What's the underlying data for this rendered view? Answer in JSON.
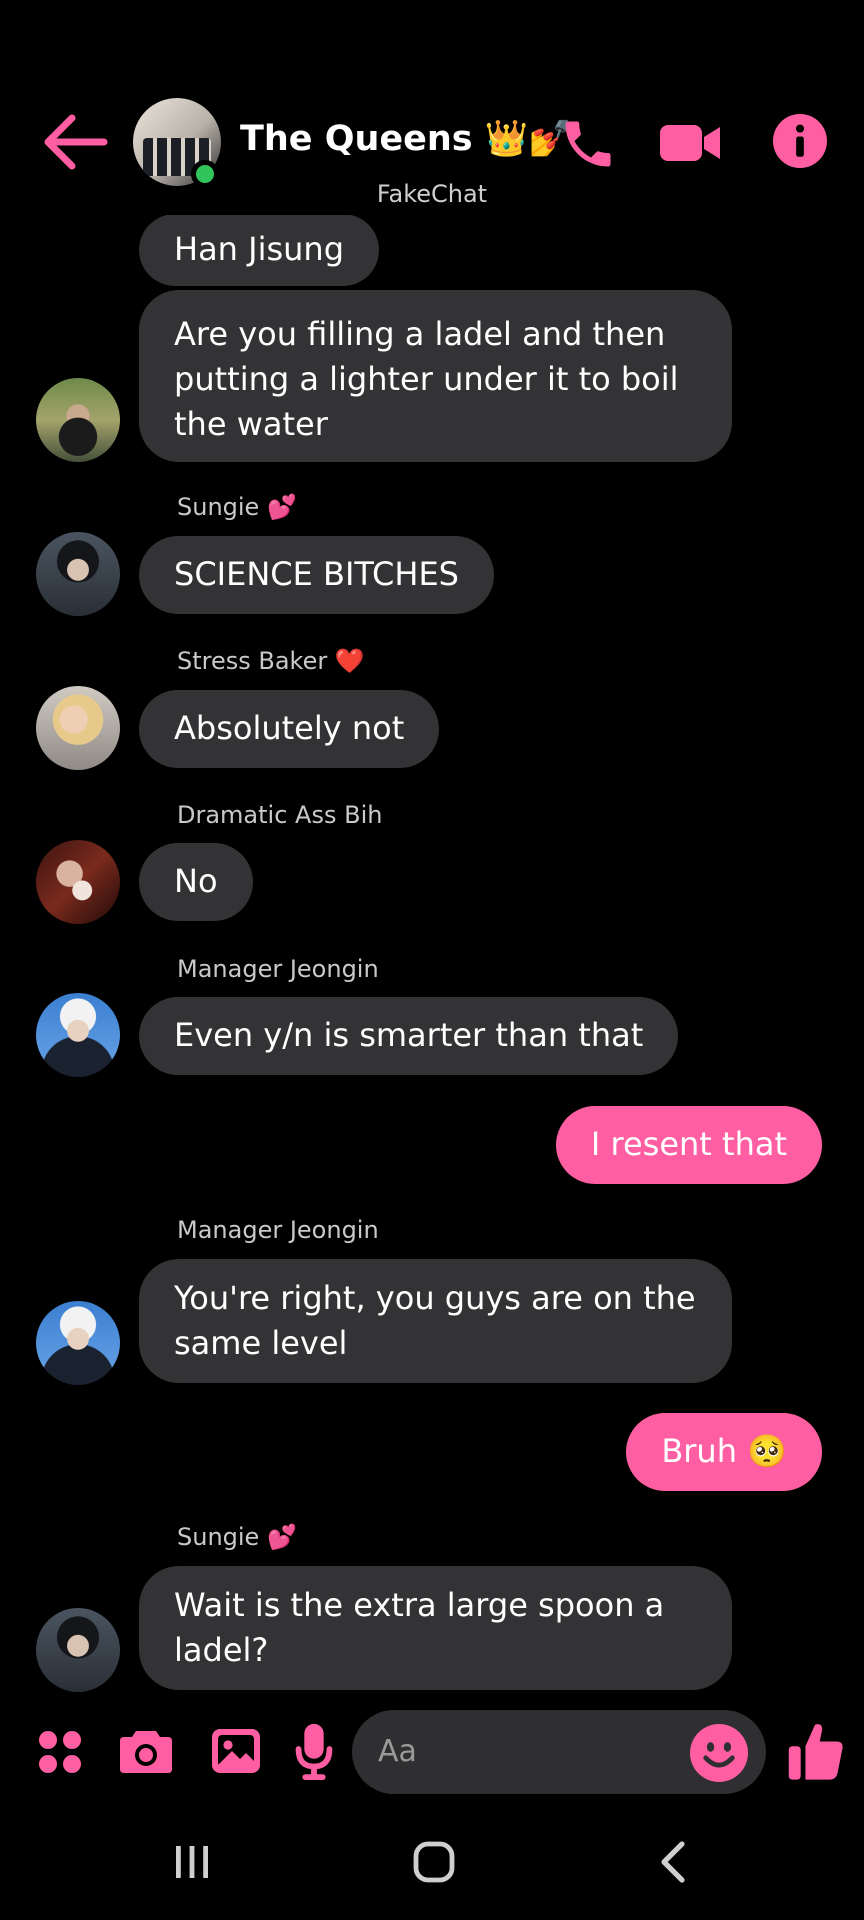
{
  "header": {
    "title": "The Queens 👑💅",
    "subtitle": "FakeChat",
    "accent": "#ff5fa2",
    "icons": [
      "back-arrow-icon",
      "phone-icon",
      "video-icon",
      "info-icon"
    ]
  },
  "messages": [
    {
      "text_lines": [
        "Han Jisung"
      ],
      "direction": "in"
    },
    {
      "text_lines": [
        "Are you filling a ladel and then",
        "putting a lighter under it to boil",
        "the water"
      ],
      "direction": "in"
    },
    {
      "sender": "Sungie",
      "sender_emoji": "💕",
      "text_lines": [
        "SCIENCE BITCHES"
      ],
      "direction": "in"
    },
    {
      "sender": "Stress Baker",
      "sender_emoji": "❤️",
      "text_lines": [
        "Absolutely not"
      ],
      "direction": "in"
    },
    {
      "sender": "Dramatic Ass Bih",
      "text_lines": [
        "No"
      ],
      "direction": "in"
    },
    {
      "sender": "Manager Jeongin",
      "text_lines": [
        "Even y/n is smarter than that"
      ],
      "direction": "in"
    },
    {
      "text_lines": [
        "I resent that"
      ],
      "direction": "out"
    },
    {
      "sender": "Manager Jeongin",
      "text_lines": [
        "You're right, you guys are on the",
        "same level"
      ],
      "direction": "in"
    },
    {
      "text_lines": [
        "Bruh 🥺"
      ],
      "direction": "out"
    },
    {
      "sender": "Sungie",
      "sender_emoji": "💕",
      "text_lines": [
        "Wait is the extra large spoon a",
        "ladel?"
      ],
      "direction": "in"
    }
  ],
  "composer": {
    "placeholder": "Aa",
    "icons": [
      "apps-icon",
      "camera-icon",
      "gallery-icon",
      "mic-icon",
      "emoji-icon",
      "thumbs-up-icon"
    ]
  },
  "navbar": {
    "icons": [
      "recent-apps-icon",
      "home-icon",
      "back-icon"
    ]
  }
}
